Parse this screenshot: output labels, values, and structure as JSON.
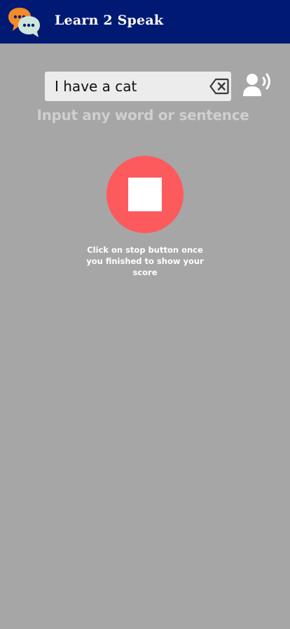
{
  "header": {
    "title": "Learn 2 Speak",
    "logo_icon": "chat-bubbles-icon",
    "background": "#001a73"
  },
  "input": {
    "value": "I have a cat",
    "clear_icon": "backspace-clear-icon",
    "speaker_icon": "speak-person-icon"
  },
  "hint": "Input any word or sentence",
  "recorder": {
    "button_icon": "stop-icon",
    "button_color": "#fd5a5d",
    "instruction": "Click on stop button once you finished to show your score"
  },
  "colors": {
    "page_background": "#a6a6a6",
    "hint_text": "#cfcfcf"
  }
}
